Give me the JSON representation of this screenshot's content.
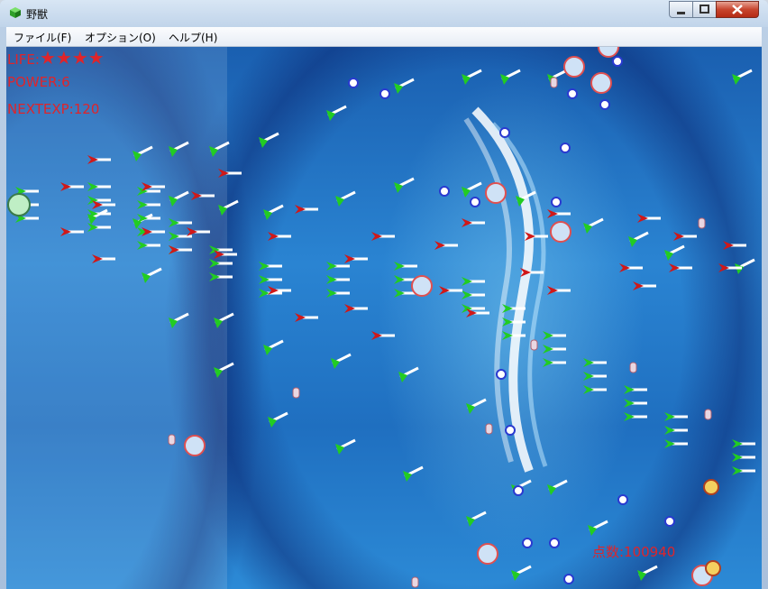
{
  "window": {
    "title": "野獣",
    "menu": [
      "ファイル(F)",
      "オプション(O)",
      "ヘルプ(H)"
    ]
  },
  "hud": {
    "life_label": "LIFE:",
    "life_stars": "★★★★",
    "power": "POWER:6",
    "next_exp": "NEXTEXP:120",
    "score": "点数:100940"
  },
  "colors": {
    "hud_text": "#e0242a",
    "enemy_green": "#22cc22",
    "enemy_red": "#d01818",
    "bullet_ring": "#e05050"
  }
}
